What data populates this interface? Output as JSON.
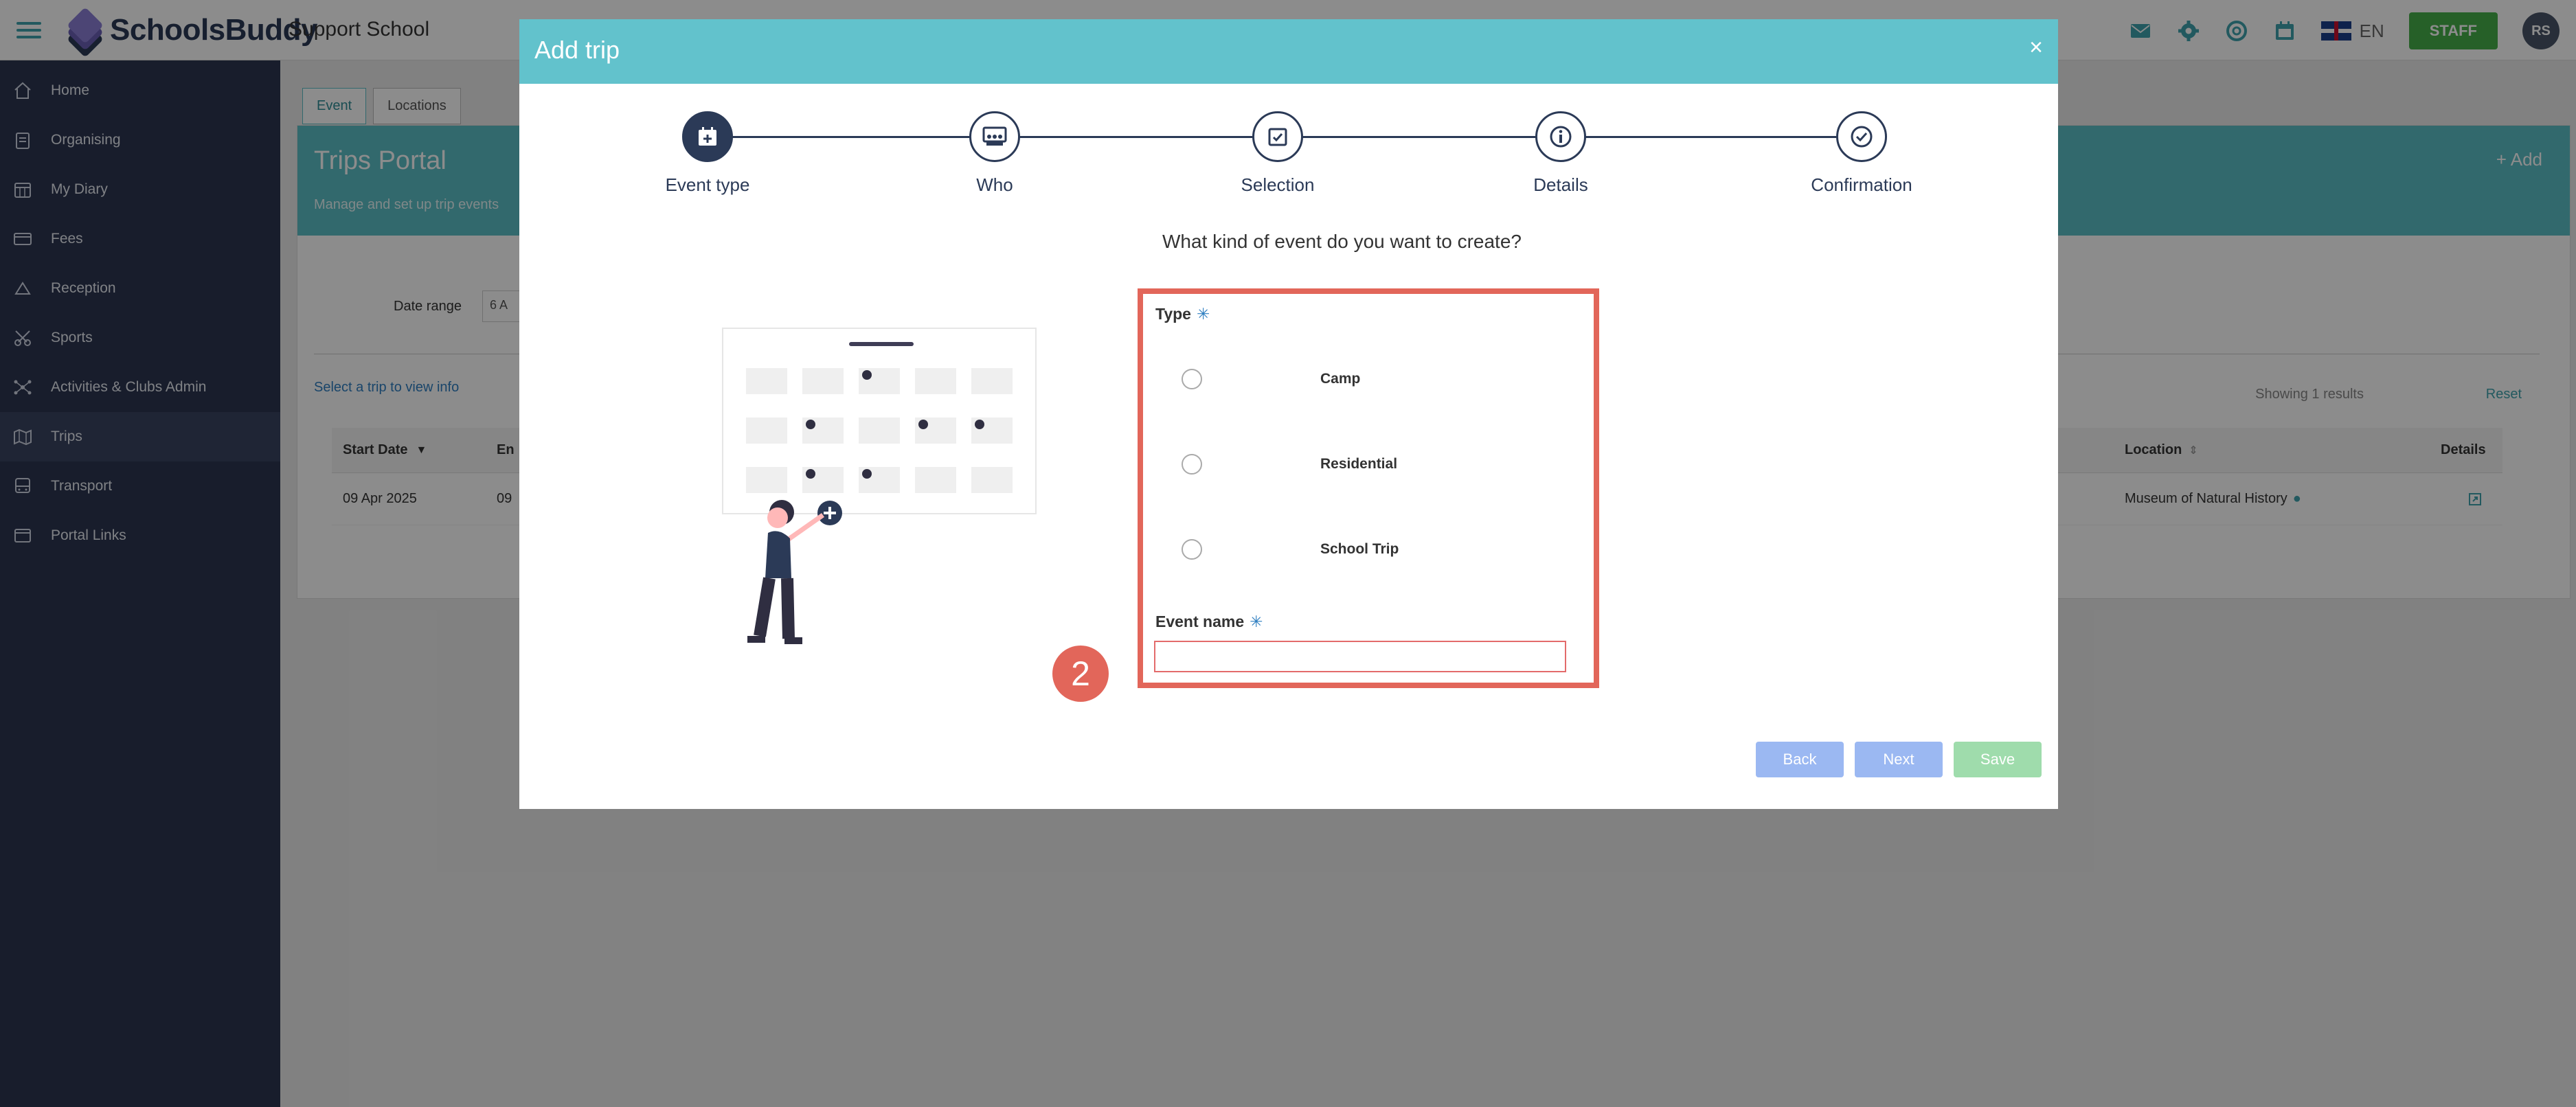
{
  "app": {
    "brand": "SchoolsBuddy",
    "school_name": "Support School",
    "language": "EN",
    "staff_label": "STAFF",
    "avatar_initials": "RS",
    "accent_color": "#5bbfc7"
  },
  "sidebar": {
    "items": [
      {
        "label": "Home",
        "icon": "home-icon"
      },
      {
        "label": "Organising",
        "icon": "clipboard-icon"
      },
      {
        "label": "My Diary",
        "icon": "calendar-icon"
      },
      {
        "label": "Fees",
        "icon": "card-icon"
      },
      {
        "label": "Reception",
        "icon": "bell-icon"
      },
      {
        "label": "Sports",
        "icon": "sports-icon"
      },
      {
        "label": "Activities & Clubs Admin",
        "icon": "network-icon"
      },
      {
        "label": "Trips",
        "icon": "map-icon"
      },
      {
        "label": "Transport",
        "icon": "bus-icon"
      },
      {
        "label": "Portal Links",
        "icon": "link-icon"
      }
    ]
  },
  "page": {
    "tabs": [
      "Event",
      "Locations"
    ],
    "title": "Trips Portal",
    "subtitle": "Manage and set up trip events",
    "add_label": "+ Add",
    "date_range_label": "Date range",
    "date_value": "6 A",
    "select_info": "Select a trip to view info",
    "showing": "Showing 1 results",
    "reset": "Reset",
    "table": {
      "headers": {
        "start": "Start Date",
        "end": "En",
        "location": "Location",
        "details": "Details"
      },
      "row": {
        "start": "09 Apr 2025",
        "end": "09",
        "location": "Museum of Natural History"
      }
    }
  },
  "modal": {
    "title": "Add trip",
    "close": "×",
    "steps": [
      "Event type",
      "Who",
      "Selection",
      "Details",
      "Confirmation"
    ],
    "question": "What kind of event do you want to create?",
    "type_label": "Type",
    "required_mark": "✳",
    "options": [
      "Camp",
      "Residential",
      "School Trip"
    ],
    "event_name_label": "Event name",
    "event_name_value": "",
    "buttons": {
      "back": "Back",
      "next": "Next",
      "save": "Save"
    },
    "badge": "2",
    "highlight_color": "#e2665a"
  }
}
